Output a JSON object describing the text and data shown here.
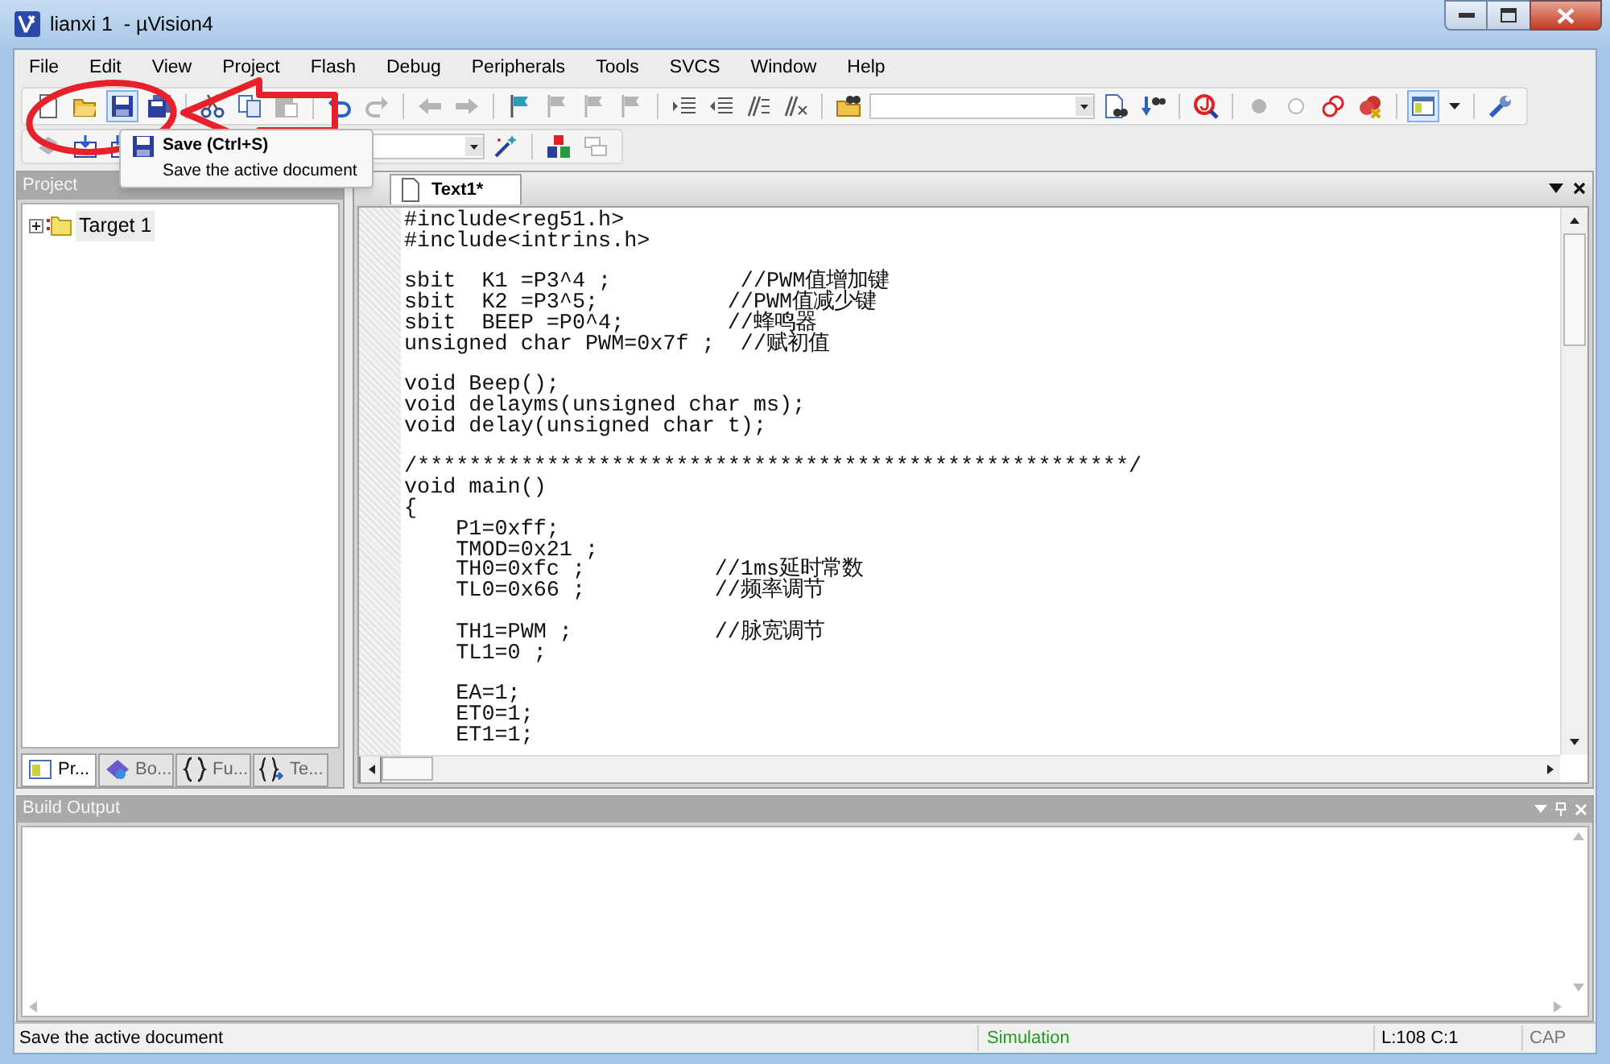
{
  "window": {
    "title": "lianxi 1  - µVision4"
  },
  "menu": [
    "File",
    "Edit",
    "View",
    "Project",
    "Flash",
    "Debug",
    "Peripherals",
    "Tools",
    "SVCS",
    "Window",
    "Help"
  ],
  "toolbar_1": [
    {
      "kind": "new",
      "disabled": false,
      "highlighted": false
    },
    {
      "kind": "open",
      "disabled": false,
      "highlighted": false
    },
    {
      "kind": "save",
      "disabled": false,
      "highlighted": true
    },
    {
      "kind": "saveall",
      "disabled": false,
      "highlighted": false
    },
    {
      "kind": "separator"
    },
    {
      "kind": "cut",
      "disabled": false,
      "highlighted": false
    },
    {
      "kind": "copy",
      "disabled": false,
      "highlighted": false
    },
    {
      "kind": "paste",
      "disabled": true,
      "highlighted": false
    },
    {
      "kind": "separator"
    },
    {
      "kind": "undo",
      "disabled": false,
      "highlighted": false
    },
    {
      "kind": "redo",
      "disabled": true,
      "highlighted": false
    },
    {
      "kind": "separator"
    },
    {
      "kind": "back",
      "disabled": true,
      "highlighted": false
    },
    {
      "kind": "forward",
      "disabled": true,
      "highlighted": false
    },
    {
      "kind": "separator"
    },
    {
      "kind": "bookmark",
      "disabled": false,
      "highlighted": false
    },
    {
      "kind": "bookmark",
      "disabled": true,
      "highlighted": false
    },
    {
      "kind": "bookmark",
      "disabled": true,
      "highlighted": false
    },
    {
      "kind": "bookmark",
      "disabled": true,
      "highlighted": false
    },
    {
      "kind": "separator"
    },
    {
      "kind": "indent",
      "disabled": false,
      "highlighted": false
    },
    {
      "kind": "outdent",
      "disabled": false,
      "highlighted": false
    },
    {
      "kind": "comment",
      "disabled": false,
      "highlighted": false
    },
    {
      "kind": "uncomment",
      "disabled": false,
      "highlighted": false
    },
    {
      "kind": "separator"
    },
    {
      "kind": "findfiles",
      "disabled": false,
      "highlighted": false
    },
    {
      "kind": "combo"
    },
    {
      "kind": "find",
      "disabled": false,
      "highlighted": false
    },
    {
      "kind": "incfind",
      "disabled": false,
      "highlighted": false
    },
    {
      "kind": "separator"
    },
    {
      "kind": "debug",
      "disabled": false,
      "highlighted": false
    },
    {
      "kind": "separator"
    },
    {
      "kind": "breakpoint",
      "disabled": true,
      "highlighted": false
    },
    {
      "kind": "bpoff",
      "disabled": true,
      "highlighted": false
    },
    {
      "kind": "bpalloff",
      "disabled": false,
      "highlighted": false
    },
    {
      "kind": "bpkill",
      "disabled": false,
      "highlighted": false
    },
    {
      "kind": "separator"
    },
    {
      "kind": "window",
      "disabled": false,
      "highlighted": true
    },
    {
      "kind": "caret",
      "disabled": false,
      "highlighted": false
    },
    {
      "kind": "separator"
    },
    {
      "kind": "wrench",
      "disabled": false,
      "highlighted": false
    }
  ],
  "toolbar_2": [
    {
      "kind": "translate",
      "disabled": true,
      "highlighted": false
    },
    {
      "kind": "build",
      "disabled": false,
      "highlighted": false
    },
    {
      "kind": "rebuild",
      "disabled": false,
      "highlighted": false
    },
    {
      "kind": "combo"
    },
    {
      "kind": "wand",
      "disabled": false,
      "highlighted": false
    },
    {
      "kind": "separator"
    },
    {
      "kind": "components",
      "disabled": false,
      "highlighted": false
    },
    {
      "kind": "packs",
      "disabled": true,
      "highlighted": false
    }
  ],
  "tooltip": {
    "title": "Save (Ctrl+S)",
    "description": "Save the active document"
  },
  "project_panel": {
    "title": "Project",
    "tree": [
      {
        "label": "Target 1",
        "expanded": false,
        "selected": true
      }
    ],
    "tabs": [
      {
        "kind": "project",
        "label": "Pr...",
        "selected": true
      },
      {
        "kind": "books",
        "label": "Bo...",
        "selected": false
      },
      {
        "kind": "functions",
        "label": "Fu...",
        "selected": false
      },
      {
        "kind": "templates",
        "label": "Te...",
        "selected": false
      }
    ]
  },
  "editor": {
    "tabs": [
      {
        "label": "Text1*",
        "selected": true
      }
    ],
    "code": "#include<reg51.h>\n#include<intrins.h>\n\nsbit  K1 =P3^4 ;          //PWM值增加键\nsbit  K2 =P3^5;          //PWM值减少键\nsbit  BEEP =P0^4;        //蜂鸣器\nunsigned char PWM=0x7f ;  //赋初值\n\nvoid Beep();\nvoid delayms(unsigned char ms);\nvoid delay(unsigned char t);\n\n/*******************************************************/\nvoid main()\n{\n    P1=0xff;\n    TMOD=0x21 ;\n    TH0=0xfc ;          //1ms延时常数\n    TL0=0x66 ;          //频率调节\n\n    TH1=PWM ;           //脉宽调节\n    TL1=0 ;\n\n    EA=1;\n    ET0=1;\n    ET1=1;"
  },
  "build_output": {
    "title": "Build Output"
  },
  "status_bar": {
    "message": "Save the active document",
    "mode": "Simulation",
    "position": "L:108 C:1",
    "caps": "CAP"
  },
  "annotations": [
    {
      "kind": "ellipse"
    },
    {
      "kind": "arrow"
    }
  ]
}
